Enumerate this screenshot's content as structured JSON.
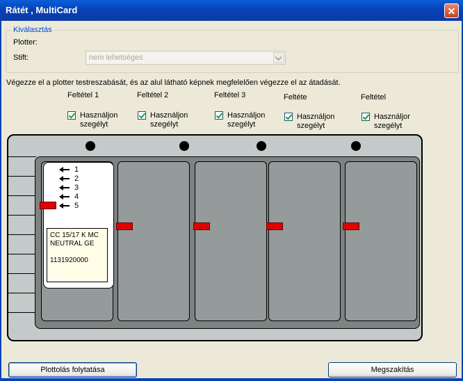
{
  "window": {
    "title": "Rátét , MultiCard"
  },
  "selection": {
    "group_title": "Kiválasztás",
    "plotter_label": "Plotter:",
    "pen_label": "Stift:",
    "pen_select_value": "nem lehetséges"
  },
  "instruction": "Végezze el a plotter testreszabását, és az alul látható képnek megfelelően végezze el az átadását.",
  "conditions": [
    {
      "label": "Feltétel 1",
      "checkbox_line1": "Használjon",
      "checkbox_line2": "szegélyt"
    },
    {
      "label": "Feltétel 2",
      "checkbox_line1": "Használjon",
      "checkbox_line2": "szegélyt"
    },
    {
      "label": "Feltétel 3",
      "checkbox_line1": "Használjon",
      "checkbox_line2": "szegélyt"
    },
    {
      "label": "Feltéte",
      "checkbox_line1": "Használjon",
      "checkbox_line2": "szegélyt"
    },
    {
      "label": "Feltétel",
      "checkbox_line1": "Használjor",
      "checkbox_line2": "szegélyt"
    }
  ],
  "card": {
    "positions": [
      "1",
      "2",
      "3",
      "4",
      "5"
    ],
    "info_line1": "CC 15/17 K MC",
    "info_line2": "NEUTRAL GE",
    "info_line3": "1131920000"
  },
  "buttons": {
    "continue": "Plottolás folytatása",
    "cancel": "Megszakítás"
  }
}
